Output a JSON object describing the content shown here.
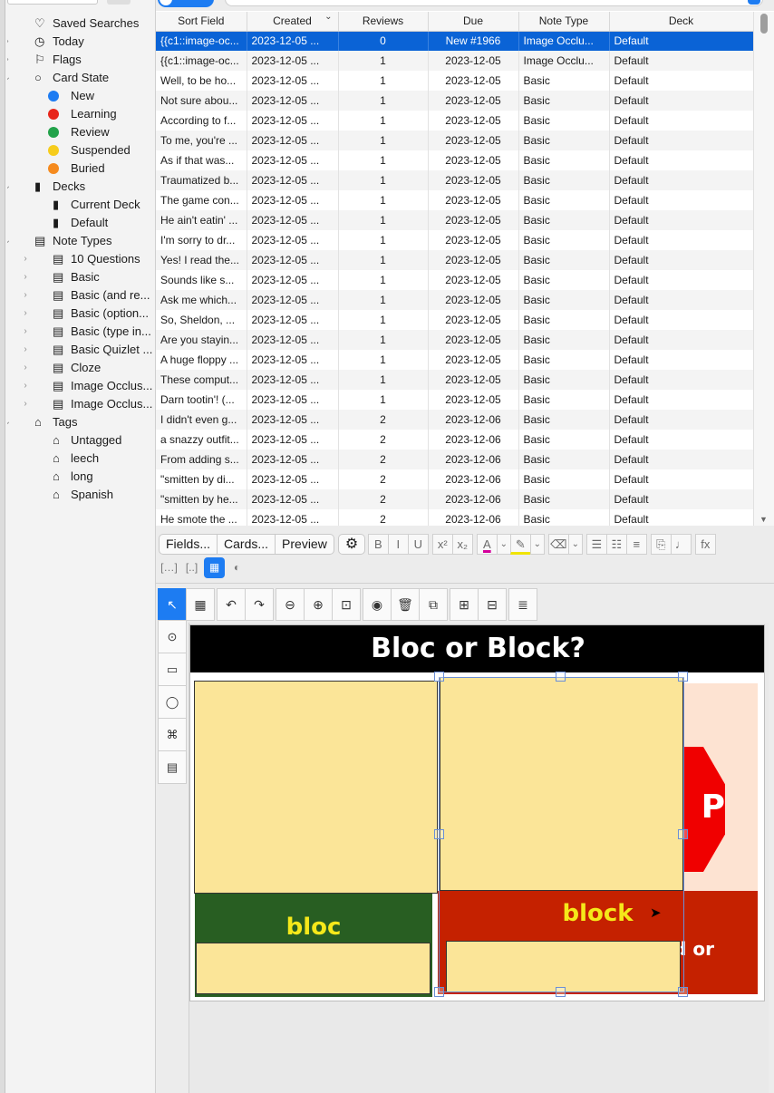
{
  "sidebar": {
    "items": [
      {
        "name": "saved-searches",
        "label": "Saved Searches",
        "chev": "",
        "indent": 0,
        "icon": "heart-icon",
        "glyph": "♡"
      },
      {
        "name": "today",
        "label": "Today",
        "chev": "›",
        "indent": 0,
        "icon": "clock-icon",
        "glyph": "◷"
      },
      {
        "name": "flags",
        "label": "Flags",
        "chev": "›",
        "indent": 0,
        "icon": "flag-icon",
        "glyph": "⚐"
      },
      {
        "name": "card-state",
        "label": "Card State",
        "chev": "⌄",
        "indent": 0,
        "icon": "circle-icon",
        "glyph": "○"
      },
      {
        "name": "new",
        "label": "New",
        "chev": "",
        "indent": 1,
        "dot": "#1d7cf2"
      },
      {
        "name": "learning",
        "label": "Learning",
        "chev": "",
        "indent": 1,
        "dot": "#e8261b"
      },
      {
        "name": "review",
        "label": "Review",
        "chev": "",
        "indent": 1,
        "dot": "#22a24a"
      },
      {
        "name": "suspended",
        "label": "Suspended",
        "chev": "",
        "indent": 1,
        "dot": "#f6cc1c"
      },
      {
        "name": "buried",
        "label": "Buried",
        "chev": "",
        "indent": 1,
        "dot": "#f58a1e"
      },
      {
        "name": "decks",
        "label": "Decks",
        "chev": "⌄",
        "indent": 0,
        "icon": "deck-icon",
        "glyph": "▮"
      },
      {
        "name": "current-deck",
        "label": "Current Deck",
        "chev": "",
        "indent": 1,
        "icon": "current-deck-icon",
        "glyph": "▮"
      },
      {
        "name": "default",
        "label": "Default",
        "chev": "",
        "indent": 1,
        "icon": "deck-icon",
        "glyph": "▮"
      },
      {
        "name": "note-types",
        "label": "Note Types",
        "chev": "⌄",
        "indent": 0,
        "icon": "note-type-icon",
        "glyph": "▤"
      },
      {
        "name": "10-questions",
        "label": "10 Questions",
        "chev": "›",
        "indent": 1,
        "icon": "note-type-icon",
        "glyph": "▤"
      },
      {
        "name": "basic",
        "label": "Basic",
        "chev": "›",
        "indent": 1,
        "icon": "note-type-icon",
        "glyph": "▤"
      },
      {
        "name": "basic-and-reversed",
        "label": "Basic (and re...",
        "chev": "›",
        "indent": 1,
        "icon": "note-type-icon",
        "glyph": "▤"
      },
      {
        "name": "basic-optional",
        "label": "Basic (option...",
        "chev": "›",
        "indent": 1,
        "icon": "note-type-icon",
        "glyph": "▤"
      },
      {
        "name": "basic-type-in",
        "label": "Basic (type in...",
        "chev": "›",
        "indent": 1,
        "icon": "note-type-icon",
        "glyph": "▤"
      },
      {
        "name": "basic-quizlet",
        "label": "Basic Quizlet ...",
        "chev": "›",
        "indent": 1,
        "icon": "note-type-icon",
        "glyph": "▤"
      },
      {
        "name": "cloze",
        "label": "Cloze",
        "chev": "›",
        "indent": 1,
        "icon": "note-type-icon",
        "glyph": "▤"
      },
      {
        "name": "image-occlusion-1",
        "label": "Image Occlus...",
        "chev": "›",
        "indent": 1,
        "icon": "note-type-icon",
        "glyph": "▤"
      },
      {
        "name": "image-occlusion-2",
        "label": "Image Occlus...",
        "chev": "›",
        "indent": 1,
        "icon": "note-type-icon",
        "glyph": "▤"
      },
      {
        "name": "tags",
        "label": "Tags",
        "chev": "⌄",
        "indent": 0,
        "icon": "tag-icon",
        "glyph": "⌂"
      },
      {
        "name": "untagged",
        "label": "Untagged",
        "chev": "",
        "indent": 1,
        "icon": "untagged-icon",
        "glyph": "⌂"
      },
      {
        "name": "leech",
        "label": "leech",
        "chev": "",
        "indent": 1,
        "icon": "tag-icon",
        "glyph": "⌂"
      },
      {
        "name": "long",
        "label": "long",
        "chev": "",
        "indent": 1,
        "icon": "tag-icon",
        "glyph": "⌂"
      },
      {
        "name": "spanish",
        "label": "Spanish",
        "chev": "",
        "indent": 1,
        "icon": "tag-icon",
        "glyph": "⌂"
      }
    ]
  },
  "table": {
    "columns": [
      "Sort Field",
      "Created",
      "Reviews",
      "Due",
      "Note Type",
      "Deck"
    ],
    "sort_indicator": "⌄",
    "selected_row": 0,
    "rows": [
      [
        "{{c1::image-oc...",
        "2023-12-05 ...",
        "0",
        "New #1966",
        "Image Occlu...",
        "Default"
      ],
      [
        "{{c1::image-oc...",
        "2023-12-05 ...",
        "1",
        "2023-12-05",
        "Image Occlu...",
        "Default"
      ],
      [
        "Well, to be ho...",
        "2023-12-05 ...",
        "1",
        "2023-12-05",
        "Basic",
        "Default"
      ],
      [
        "Not sure abou...",
        "2023-12-05 ...",
        "1",
        "2023-12-05",
        "Basic",
        "Default"
      ],
      [
        "According to f...",
        "2023-12-05 ...",
        "1",
        "2023-12-05",
        "Basic",
        "Default"
      ],
      [
        "To me, you're ...",
        "2023-12-05 ...",
        "1",
        "2023-12-05",
        "Basic",
        "Default"
      ],
      [
        "As if that was...",
        "2023-12-05 ...",
        "1",
        "2023-12-05",
        "Basic",
        "Default"
      ],
      [
        "Traumatized b...",
        "2023-12-05 ...",
        "1",
        "2023-12-05",
        "Basic",
        "Default"
      ],
      [
        "The game con...",
        "2023-12-05 ...",
        "1",
        "2023-12-05",
        "Basic",
        "Default"
      ],
      [
        "He ain't eatin' ...",
        "2023-12-05 ...",
        "1",
        "2023-12-05",
        "Basic",
        "Default"
      ],
      [
        "I'm sorry to dr...",
        "2023-12-05 ...",
        "1",
        "2023-12-05",
        "Basic",
        "Default"
      ],
      [
        "Yes! I read the...",
        "2023-12-05 ...",
        "1",
        "2023-12-05",
        "Basic",
        "Default"
      ],
      [
        "Sounds like s...",
        "2023-12-05 ...",
        "1",
        "2023-12-05",
        "Basic",
        "Default"
      ],
      [
        "Ask me which...",
        "2023-12-05 ...",
        "1",
        "2023-12-05",
        "Basic",
        "Default"
      ],
      [
        "So, Sheldon, ...",
        "2023-12-05 ...",
        "1",
        "2023-12-05",
        "Basic",
        "Default"
      ],
      [
        "Are you stayin...",
        "2023-12-05 ...",
        "1",
        "2023-12-05",
        "Basic",
        "Default"
      ],
      [
        "A huge floppy ...",
        "2023-12-05 ...",
        "1",
        "2023-12-05",
        "Basic",
        "Default"
      ],
      [
        "These comput...",
        "2023-12-05 ...",
        "1",
        "2023-12-05",
        "Basic",
        "Default"
      ],
      [
        "Darn tootin'! (...",
        "2023-12-05 ...",
        "1",
        "2023-12-05",
        "Basic",
        "Default"
      ],
      [
        "I didn't even g...",
        "2023-12-05 ...",
        "2",
        "2023-12-06",
        "Basic",
        "Default"
      ],
      [
        "a snazzy outfit...",
        "2023-12-05 ...",
        "2",
        "2023-12-06",
        "Basic",
        "Default"
      ],
      [
        "From adding s...",
        "2023-12-05 ...",
        "2",
        "2023-12-06",
        "Basic",
        "Default"
      ],
      [
        "\"smitten by di...",
        "2023-12-05 ...",
        "2",
        "2023-12-06",
        "Basic",
        "Default"
      ],
      [
        "\"smitten by he...",
        "2023-12-05 ...",
        "2",
        "2023-12-06",
        "Basic",
        "Default"
      ],
      [
        "He smote the ...",
        "2023-12-05 ...",
        "2",
        "2023-12-06",
        "Basic",
        "Default"
      ]
    ]
  },
  "editor": {
    "fields_label": "Fields...",
    "cards_label": "Cards...",
    "preview_label": "Preview",
    "gear_glyph": "⚙",
    "format_buttons": [
      {
        "name": "bold-icon",
        "glyph": "B"
      },
      {
        "name": "italic-icon",
        "glyph": "I"
      },
      {
        "name": "underline-icon",
        "glyph": "U"
      },
      {
        "name": "superscript-icon",
        "glyph": "x²"
      },
      {
        "name": "subscript-icon",
        "glyph": "x₂"
      },
      {
        "name": "text-color-icon",
        "glyph": "A"
      },
      {
        "name": "text-color-dropdown-icon",
        "glyph": "⌄"
      },
      {
        "name": "highlight-icon",
        "glyph": "✎"
      },
      {
        "name": "highlight-dropdown-icon",
        "glyph": "⌄"
      },
      {
        "name": "eraser-icon",
        "glyph": "⌫"
      },
      {
        "name": "eraser-dropdown-icon",
        "glyph": "⌄"
      },
      {
        "name": "bullet-list-icon",
        "glyph": "☰"
      },
      {
        "name": "numbered-list-icon",
        "glyph": "☷"
      },
      {
        "name": "align-icon",
        "glyph": "≡"
      },
      {
        "name": "attach-icon",
        "glyph": "⎘"
      },
      {
        "name": "microphone-icon",
        "glyph": "♩"
      },
      {
        "name": "formula-icon",
        "glyph": "fx"
      }
    ],
    "second_row": [
      {
        "name": "cloze-icon",
        "glyph": "[…]",
        "active": false
      },
      {
        "name": "cloze-same-icon",
        "glyph": "[..]",
        "active": false
      },
      {
        "name": "image-occlusion-mode-icon",
        "glyph": "▦",
        "active": true
      },
      {
        "name": "addon-icon",
        "glyph": "◐",
        "active": false
      }
    ],
    "io_toolbar": [
      {
        "name": "select-tool-icon",
        "glyph": "↖",
        "active": true,
        "gap": false
      },
      {
        "name": "fill-tool-icon",
        "glyph": "▦",
        "active": false,
        "gap": false
      },
      {
        "name": "undo-icon",
        "glyph": "↶",
        "active": false,
        "gap": true
      },
      {
        "name": "redo-icon",
        "glyph": "↷",
        "active": false,
        "gap": false
      },
      {
        "name": "zoom-out-icon",
        "glyph": "⊖",
        "active": false,
        "gap": true
      },
      {
        "name": "zoom-in-icon",
        "glyph": "⊕",
        "active": false,
        "gap": false
      },
      {
        "name": "zoom-reset-icon",
        "glyph": "⊡",
        "active": false,
        "gap": false
      },
      {
        "name": "toggle-translucent-icon",
        "glyph": "◉",
        "active": false,
        "gap": true
      },
      {
        "name": "delete-icon",
        "glyph": "🗑",
        "active": false,
        "gap": false
      },
      {
        "name": "duplicate-icon",
        "glyph": "⧉",
        "active": false,
        "gap": false
      },
      {
        "name": "group-icon",
        "glyph": "⊞",
        "active": false,
        "gap": true
      },
      {
        "name": "ungroup-icon",
        "glyph": "⊟",
        "active": false,
        "gap": false
      },
      {
        "name": "align-icon",
        "glyph": "≣",
        "active": false,
        "gap": true
      }
    ],
    "io_left_toolbar": [
      {
        "name": "zoom-select-icon",
        "glyph": "⊙"
      },
      {
        "name": "rectangle-tool-icon",
        "glyph": "▭"
      },
      {
        "name": "ellipse-tool-icon",
        "glyph": "◯"
      },
      {
        "name": "polygon-tool-icon",
        "glyph": "⌘"
      },
      {
        "name": "text-tool-icon",
        "glyph": "▤"
      }
    ]
  },
  "image": {
    "title": "Bloc or Block?",
    "stop_text": "P",
    "bloc_label": "bloc",
    "block_label": "block",
    "block_partial": "d or"
  },
  "colors": {
    "accent": "#1d7cf2",
    "selected_row": "#0a63d6",
    "mask_fill": "#fbe598"
  }
}
